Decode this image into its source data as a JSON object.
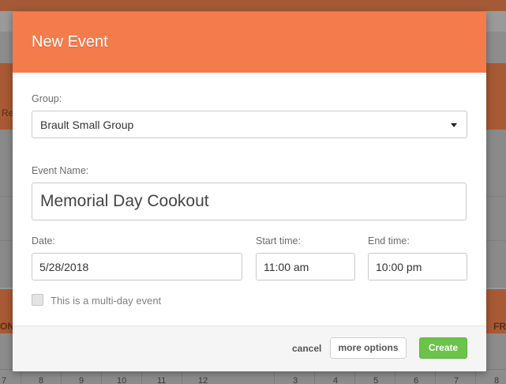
{
  "background": {
    "band_label": "Re",
    "day_left": "ON",
    "day_right": "FR",
    "calendar_numbers": [
      "7",
      "8",
      "9",
      "10",
      "11",
      "12",
      "3",
      "4",
      "5",
      "6",
      "7",
      "8"
    ]
  },
  "modal": {
    "title": "New Event",
    "group": {
      "label": "Group:",
      "value": "Brault Small Group"
    },
    "event_name": {
      "label": "Event Name:",
      "value": "Memorial Day Cookout"
    },
    "date": {
      "label": "Date:",
      "value": "5/28/2018"
    },
    "start_time": {
      "label": "Start time:",
      "value": "11:00 am"
    },
    "end_time": {
      "label": "End time:",
      "value": "10:00 pm"
    },
    "multi_day": {
      "label": "This is a multi-day event",
      "checked": false
    },
    "footer": {
      "cancel": "cancel",
      "more_options": "more options",
      "create": "Create"
    }
  },
  "colors": {
    "header": "#f47c4c",
    "create_button": "#6cc24a",
    "backdrop_band": "#a85a35"
  }
}
